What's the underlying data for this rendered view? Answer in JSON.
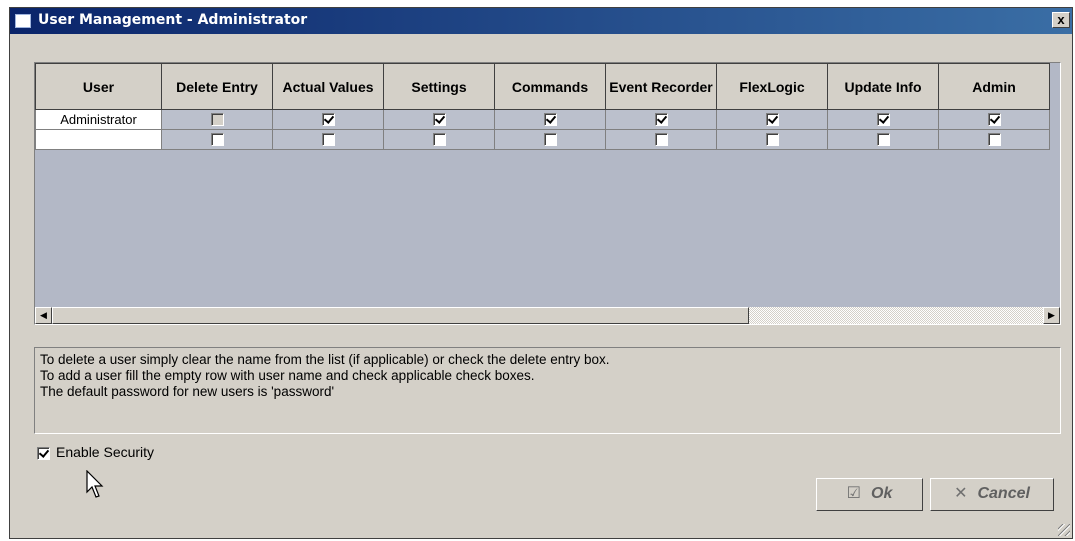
{
  "window": {
    "title": "User Management - Administrator",
    "close_label": "x"
  },
  "grid": {
    "columns": [
      "User",
      "Delete Entry",
      "Actual Values",
      "Settings",
      "Commands",
      "Event Recorder",
      "FlexLogic",
      "Update Info",
      "Admin"
    ],
    "rows": [
      {
        "user": "Administrator",
        "checks": [
          {
            "checked": false,
            "enabled": false
          },
          {
            "checked": true,
            "enabled": true
          },
          {
            "checked": true,
            "enabled": true
          },
          {
            "checked": true,
            "enabled": true
          },
          {
            "checked": true,
            "enabled": true
          },
          {
            "checked": true,
            "enabled": true
          },
          {
            "checked": true,
            "enabled": true
          },
          {
            "checked": true,
            "enabled": true
          }
        ]
      },
      {
        "user": "",
        "checks": [
          {
            "checked": false,
            "enabled": true
          },
          {
            "checked": false,
            "enabled": true
          },
          {
            "checked": false,
            "enabled": true
          },
          {
            "checked": false,
            "enabled": true
          },
          {
            "checked": false,
            "enabled": true
          },
          {
            "checked": false,
            "enabled": true
          },
          {
            "checked": false,
            "enabled": true
          },
          {
            "checked": false,
            "enabled": true
          }
        ]
      }
    ]
  },
  "info": {
    "line1": "To delete a user simply clear the name from the list (if applicable) or check the delete entry box.",
    "line2": "To add a user fill the empty row with user name and check applicable check boxes.",
    "line3": "The default password for new users is 'password'"
  },
  "security": {
    "label": "Enable Security",
    "checked": true
  },
  "buttons": {
    "ok_label": "Ok",
    "ok_icon": "checkmark-box-icon",
    "cancel_label": "Cancel",
    "cancel_icon": "x-icon"
  },
  "colors": {
    "titlebar": "#0a246a",
    "dialog_bg": "#d4d0c8",
    "grid_bg": "#b3b8c6"
  }
}
